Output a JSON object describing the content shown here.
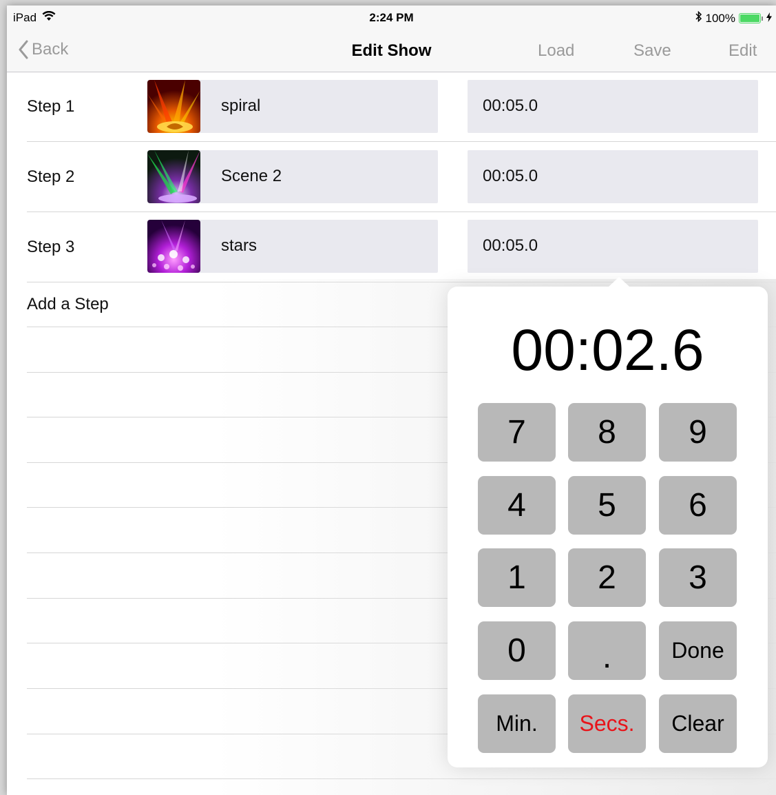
{
  "status_bar": {
    "device": "iPad",
    "time": "2:24 PM",
    "battery_percent": "100%",
    "battery_level": 1.0
  },
  "nav": {
    "back_label": "Back",
    "title": "Edit Show",
    "load_label": "Load",
    "save_label": "Save",
    "edit_label": "Edit"
  },
  "steps": [
    {
      "label": "Step 1",
      "scene": "spiral",
      "duration": "00:05.0"
    },
    {
      "label": "Step 2",
      "scene": "Scene 2",
      "duration": "00:05.0"
    },
    {
      "label": "Step 3",
      "scene": "stars",
      "duration": "00:05.0"
    }
  ],
  "add_step_label": "Add a Step",
  "keypad": {
    "display": "00:02.6",
    "keys": [
      [
        "7",
        "8",
        "9"
      ],
      [
        "4",
        "5",
        "6"
      ],
      [
        "1",
        "2",
        "3"
      ],
      [
        "0",
        ".",
        "Done"
      ],
      [
        "Min.",
        "Secs.",
        "Clear"
      ]
    ],
    "selected_unit": "Secs.",
    "selected_color": "#e8141a"
  },
  "colors": {
    "nav_inactive": "#9a9a9a",
    "field_bg": "#e9e9ef",
    "key_bg": "#b8b8b8",
    "battery": "#4cd964"
  }
}
